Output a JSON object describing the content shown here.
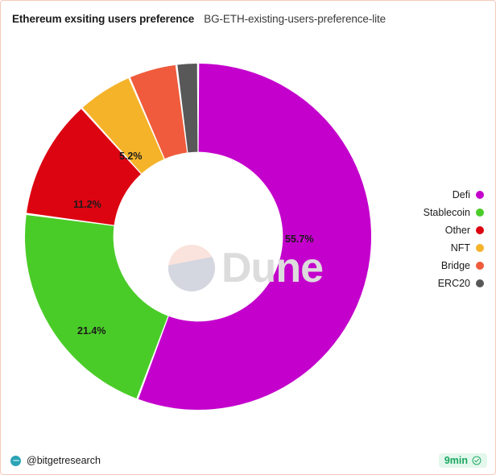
{
  "header": {
    "title": "Ethereum exsiting users preference",
    "subtitle": "BG-ETH-existing-users-preference-lite"
  },
  "watermark": {
    "text": "Dune",
    "logo_icon": "dune-logo-icon"
  },
  "footer": {
    "handle": "@bitgetresearch",
    "handle_icon": "bitget-avatar-icon",
    "time_label": "9min",
    "time_icon": "check-circle-icon",
    "badge_bg": "#e4f7ec",
    "badge_fg": "#1aa861"
  },
  "legend": {
    "position": "right",
    "items": [
      {
        "label": "Defi",
        "color": "#C400CC"
      },
      {
        "label": "Stablecoin",
        "color": "#4ACC28"
      },
      {
        "label": "Other",
        "color": "#DC0411"
      },
      {
        "label": "NFT",
        "color": "#F5B32A"
      },
      {
        "label": "Bridge",
        "color": "#EF5B3C"
      },
      {
        "label": "ERC20",
        "color": "#585858"
      }
    ]
  },
  "chart_data": {
    "type": "pie",
    "variant": "donut",
    "title": "Ethereum exsiting users preference",
    "subtitle": "BG-ETH-existing-users-preference-lite",
    "unit": "percent",
    "start_angle_deg": 0,
    "direction": "clockwise",
    "inner_radius_ratio": 0.49,
    "categories": [
      "Defi",
      "Stablecoin",
      "Other",
      "NFT",
      "Bridge",
      "ERC20"
    ],
    "values": [
      55.7,
      21.4,
      11.2,
      5.2,
      4.5,
      2.0
    ],
    "colors": [
      "#C400CC",
      "#4ACC28",
      "#DC0411",
      "#F5B32A",
      "#EF5B3C",
      "#585858"
    ],
    "slices": [
      {
        "label": "Defi",
        "value": 55.7,
        "display": "55.7%",
        "color": "#C400CC",
        "labeled": true
      },
      {
        "label": "Stablecoin",
        "value": 21.4,
        "display": "21.4%",
        "color": "#4ACC28",
        "labeled": true
      },
      {
        "label": "Other",
        "value": 11.2,
        "display": "11.2%",
        "color": "#DC0411",
        "labeled": true
      },
      {
        "label": "NFT",
        "value": 5.2,
        "display": "5.2%",
        "color": "#F5B32A",
        "labeled": true
      },
      {
        "label": "Bridge",
        "value": 4.5,
        "display": "",
        "color": "#EF5B3C",
        "labeled": false
      },
      {
        "label": "ERC20",
        "value": 2.0,
        "display": "",
        "color": "#585858",
        "labeled": false
      }
    ],
    "labels": {
      "defi": "55.7%",
      "stablecoin": "21.4%",
      "other": "11.2%",
      "nft": "5.2%"
    },
    "legend": [
      "Defi",
      "Stablecoin",
      "Other",
      "NFT",
      "Bridge",
      "ERC20"
    ],
    "grid": false,
    "xlabel": "",
    "ylabel": ""
  }
}
